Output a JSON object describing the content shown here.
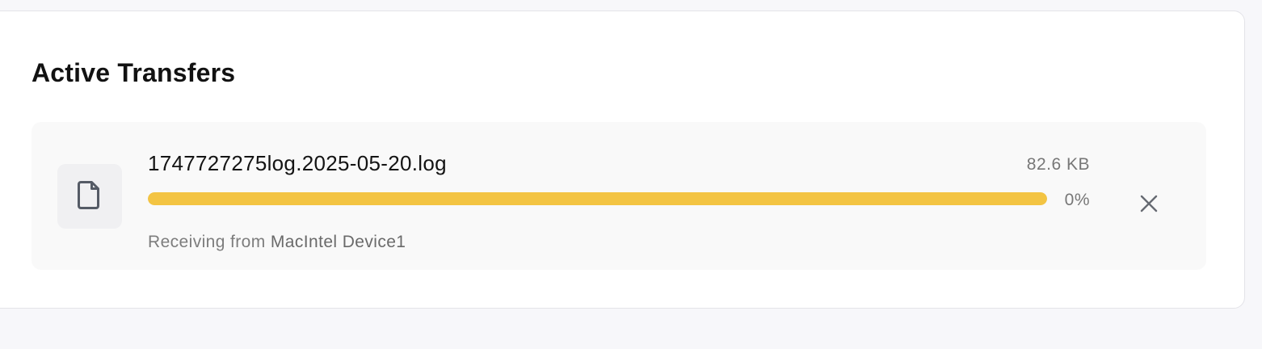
{
  "section": {
    "title": "Active Transfers"
  },
  "transfers": [
    {
      "file_name": "1747727275log.2025-05-20.log",
      "file_size": "82.6 KB",
      "progress_percent": 0,
      "progress_text": "0%",
      "direction_label": "Receiving from",
      "device_name": "MacIntel Device1",
      "file_icon": "file-icon",
      "close_icon": "close-icon"
    }
  ],
  "colors": {
    "progress_fill": "#f3c443",
    "card_background": "#ffffff",
    "item_background": "#f9f9f9",
    "icon_box_background": "#f0f0f2"
  }
}
